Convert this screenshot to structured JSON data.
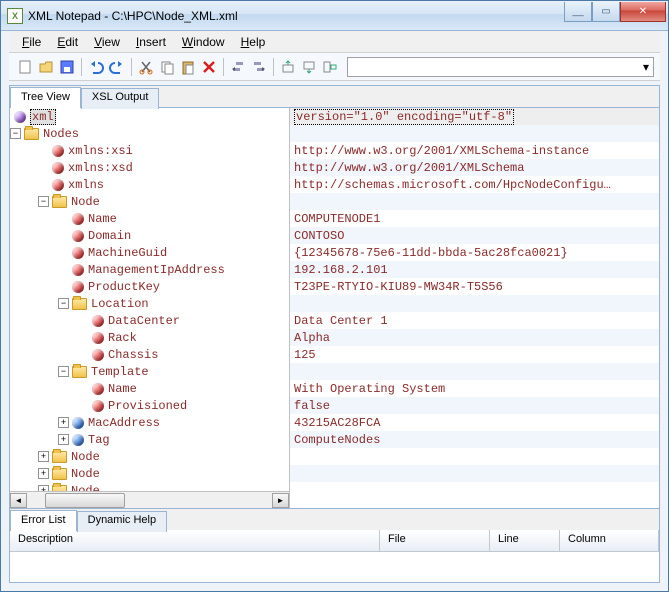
{
  "title": "XML Notepad - C:\\HPC\\Node_XML.xml",
  "menus": {
    "file": "File",
    "edit": "Edit",
    "view": "View",
    "insert": "Insert",
    "window": "Window",
    "help": "Help"
  },
  "tabs": {
    "treeView": "Tree View",
    "xslOutput": "XSL Output"
  },
  "bottomTabs": {
    "errorList": "Error List",
    "dynamicHelp": "Dynamic Help"
  },
  "gridHeaders": {
    "description": "Description",
    "file": "File",
    "line": "Line",
    "column": "Column"
  },
  "tree": {
    "root": "xml",
    "nodes": "Nodes",
    "xmlns_xsi": "xmlns:xsi",
    "xmlns_xsd": "xmlns:xsd",
    "xmlns": "xmlns",
    "node": "Node",
    "name": "Name",
    "domain": "Domain",
    "machineGuid": "MachineGuid",
    "mgmtIp": "ManagementIpAddress",
    "productKey": "ProductKey",
    "location": "Location",
    "dataCenter": "DataCenter",
    "rack": "Rack",
    "chassis": "Chassis",
    "template": "Template",
    "provisioned": "Provisioned",
    "macAddress": "MacAddress",
    "tag": "Tag"
  },
  "values": {
    "xmlDecl": "version=\"1.0\" encoding=\"utf-8\"",
    "xsi": "http://www.w3.org/2001/XMLSchema-instance",
    "xsd": "http://www.w3.org/2001/XMLSchema",
    "xmlns": "http://schemas.microsoft.com/HpcNodeConfigu…",
    "name": "COMPUTENODE1",
    "domain": "CONTOSO",
    "guid": "{12345678-75e6-11dd-bbda-5ac28fca0021}",
    "ip": "192.168.2.101",
    "pkey": "T23PE-RTYIO-KIU89-MW34R-T5S56",
    "dataCenter": "Data Center 1",
    "rack": "Alpha",
    "chassis": "125",
    "tname": "With Operating System",
    "provisioned": "false",
    "mac": "43215AC28FCA",
    "tag": "ComputeNodes"
  }
}
